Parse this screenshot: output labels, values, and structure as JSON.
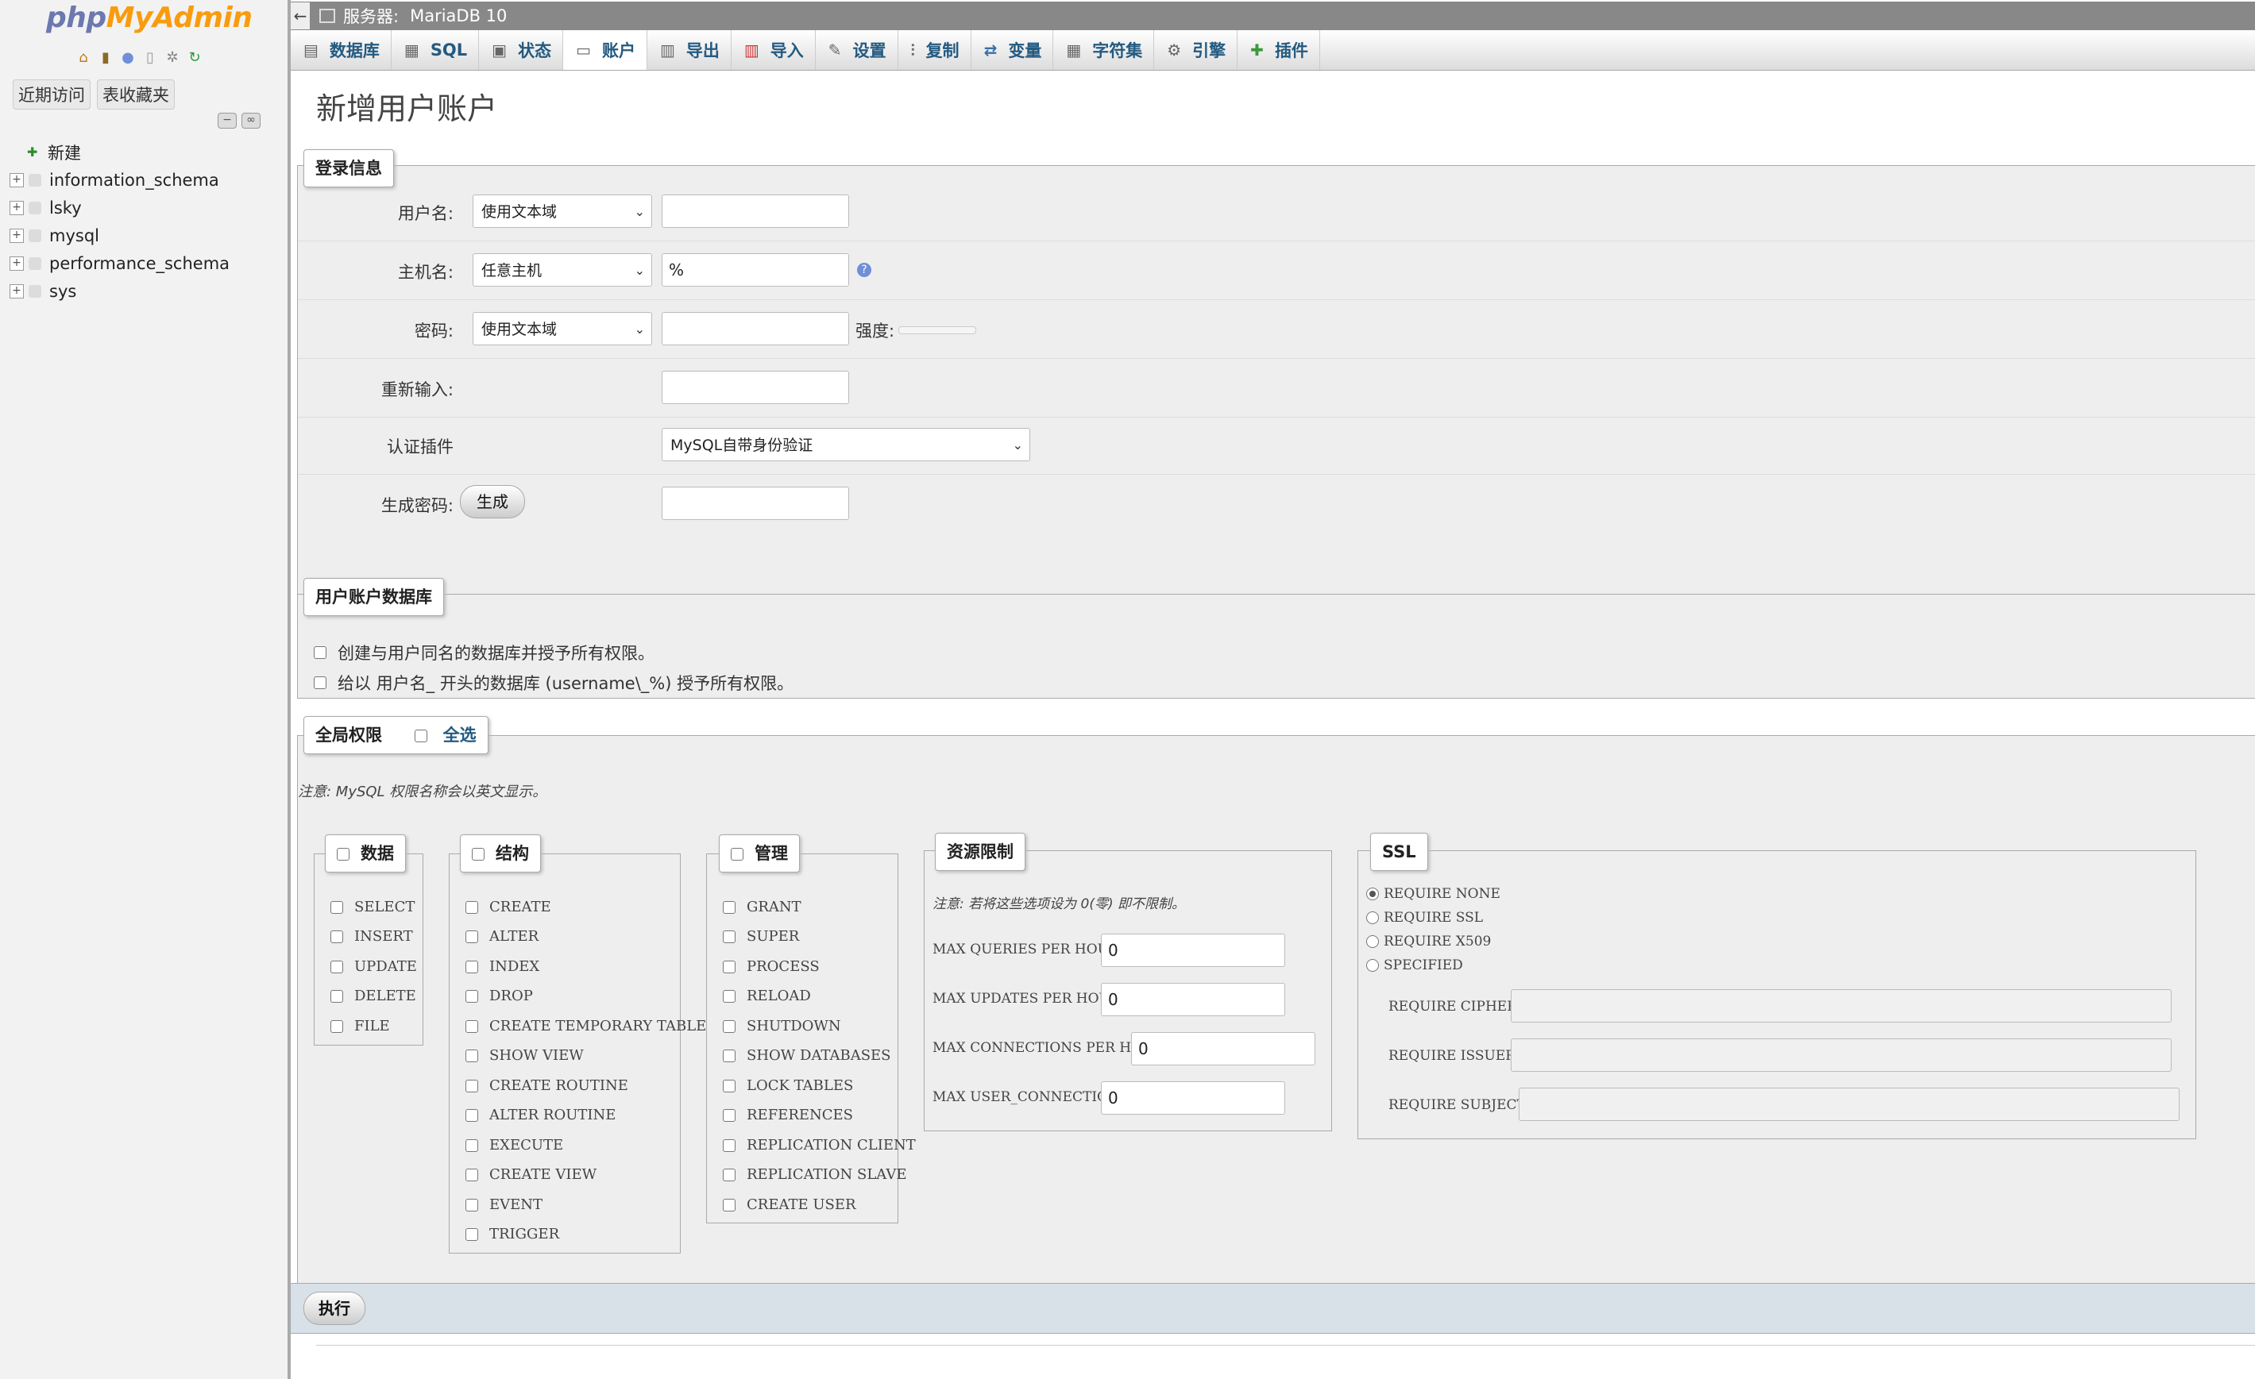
{
  "sidebar": {
    "logo_php": "php",
    "logo_myadmin": "MyAdmin",
    "recent_button": "近期访问",
    "favorites_button": "表收藏夹",
    "tree": [
      {
        "label": "新建"
      },
      {
        "label": "information_schema"
      },
      {
        "label": "lsky"
      },
      {
        "label": "mysql"
      },
      {
        "label": "performance_schema"
      },
      {
        "label": "sys"
      }
    ]
  },
  "serverbar": {
    "label": "服务器:",
    "server": "MariaDB 10"
  },
  "tabs": [
    {
      "label": "数据库",
      "icon": "database-icon"
    },
    {
      "label": "SQL",
      "icon": "sql-icon"
    },
    {
      "label": "状态",
      "icon": "status-icon"
    },
    {
      "label": "账户",
      "icon": "accounts-icon"
    },
    {
      "label": "导出",
      "icon": "export-icon"
    },
    {
      "label": "导入",
      "icon": "import-icon"
    },
    {
      "label": "设置",
      "icon": "settings-icon"
    },
    {
      "label": "复制",
      "icon": "replication-icon"
    },
    {
      "label": "变量",
      "icon": "variables-icon"
    },
    {
      "label": "字符集",
      "icon": "charset-icon"
    },
    {
      "label": "引擎",
      "icon": "engine-icon"
    },
    {
      "label": "插件",
      "icon": "plugin-icon"
    }
  ],
  "active_tab": "账户",
  "page": {
    "title": "新增用户账户"
  },
  "login": {
    "legend": "登录信息",
    "username_label": "用户名:",
    "username_select": "使用文本域",
    "username_value": "",
    "host_label": "主机名:",
    "host_select": "任意主机",
    "host_value": "%",
    "password_label": "密码:",
    "password_select": "使用文本域",
    "password_value": "",
    "strength_label": "强度:",
    "reenter_label": "重新输入:",
    "reenter_value": "",
    "auth_label": "认证插件",
    "auth_select": "MySQL自带身份验证",
    "generate_label": "生成密码:",
    "generate_button": "生成",
    "generate_value": ""
  },
  "userdb": {
    "legend": "用户账户数据库",
    "option1": "创建与用户同名的数据库并授予所有权限。",
    "option2": "给以 用户名_ 开头的数据库 (username\\_%) 授予所有权限。"
  },
  "global": {
    "legend": "全局权限",
    "select_all": "全选",
    "note": "注意: MySQL 权限名称会以英文显示。",
    "data": {
      "legend": "数据",
      "items": [
        "SELECT",
        "INSERT",
        "UPDATE",
        "DELETE",
        "FILE"
      ]
    },
    "structure": {
      "legend": "结构",
      "items": [
        "CREATE",
        "ALTER",
        "INDEX",
        "DROP",
        "CREATE TEMPORARY TABLES",
        "SHOW VIEW",
        "CREATE ROUTINE",
        "ALTER ROUTINE",
        "EXECUTE",
        "CREATE VIEW",
        "EVENT",
        "TRIGGER"
      ]
    },
    "admin": {
      "legend": "管理",
      "items": [
        "GRANT",
        "SUPER",
        "PROCESS",
        "RELOAD",
        "SHUTDOWN",
        "SHOW DATABASES",
        "LOCK TABLES",
        "REFERENCES",
        "REPLICATION CLIENT",
        "REPLICATION SLAVE",
        "CREATE USER"
      ]
    },
    "resources": {
      "legend": "资源限制",
      "note": "注意: 若将这些选项设为 0(零) 即不限制。",
      "items": [
        {
          "label": "MAX QUERIES PER HOUR",
          "value": "0"
        },
        {
          "label": "MAX UPDATES PER HOUR",
          "value": "0"
        },
        {
          "label": "MAX CONNECTIONS PER HOUR",
          "value": "0"
        },
        {
          "label": "MAX USER_CONNECTIONS",
          "value": "0"
        }
      ]
    },
    "ssl": {
      "legend": "SSL",
      "options": [
        "REQUIRE NONE",
        "REQUIRE SSL",
        "REQUIRE X509",
        "SPECIFIED"
      ],
      "selected": "REQUIRE NONE",
      "fields": [
        {
          "label": "REQUIRE CIPHER",
          "value": ""
        },
        {
          "label": "REQUIRE ISSUER",
          "value": ""
        },
        {
          "label": "REQUIRE SUBJECT",
          "value": ""
        }
      ]
    }
  },
  "execute_button": "执行"
}
